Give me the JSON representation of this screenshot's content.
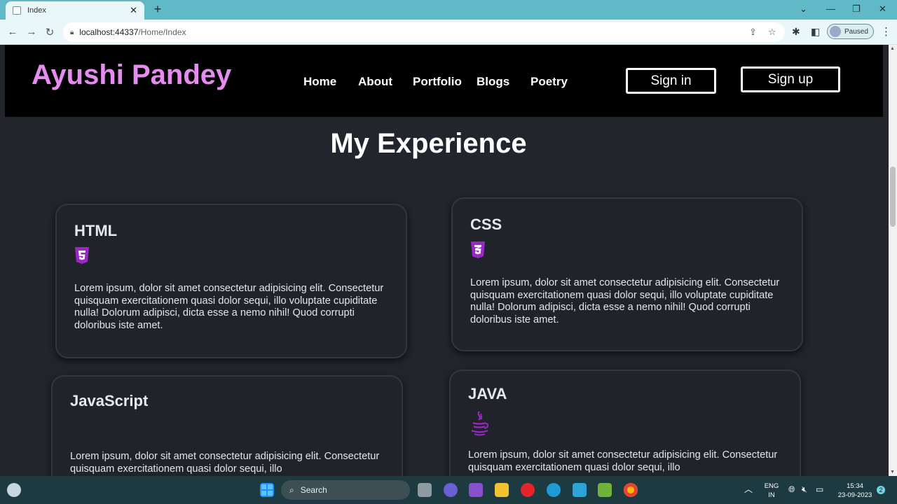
{
  "browser": {
    "tab_title": "Index",
    "tab_close": "✕",
    "new_tab": "+",
    "url_host": "localhost:44337",
    "url_path": "/Home/Index",
    "profile_status": "Paused",
    "window_min": "—",
    "window_restore": "❐",
    "window_close": "✕",
    "chevron": "⌄"
  },
  "site": {
    "brand": "Ayushi Pandey",
    "nav": [
      "Home",
      "About",
      "Portfolio",
      "Blogs",
      "Poetry"
    ],
    "sign_in": "Sign in",
    "sign_up": "Sign up",
    "section_title": "My Experience"
  },
  "cards": [
    {
      "title": "HTML",
      "icon": "html5-icon",
      "text": "Lorem ipsum, dolor sit amet consectetur adipisicing elit. Consectetur quisquam exercitationem quasi dolor sequi, illo voluptate cupiditate nulla! Dolorum adipisci, dicta esse a nemo nihil! Quod corrupti doloribus iste amet."
    },
    {
      "title": "CSS",
      "icon": "css3-icon",
      "text": "Lorem ipsum, dolor sit amet consectetur adipisicing elit. Consectetur quisquam exercitationem quasi dolor sequi, illo voluptate cupiditate nulla! Dolorum adipisci, dicta esse a nemo nihil! Quod corrupti doloribus iste amet."
    },
    {
      "title": "JavaScript",
      "icon": "",
      "text": "Lorem ipsum, dolor sit amet consectetur adipisicing elit. Consectetur quisquam exercitationem quasi dolor sequi, illo"
    },
    {
      "title": "JAVA",
      "icon": "java-icon",
      "text": "Lorem ipsum, dolor sit amet consectetur adipisicing elit. Consectetur quisquam exercitationem quasi dolor sequi, illo"
    }
  ],
  "taskbar": {
    "search_label": "Search",
    "lang_line1": "ENG",
    "lang_line2": "IN",
    "time": "15:34",
    "date": "23-09-2023",
    "notification_count": "2"
  },
  "colors": {
    "brand": "#e68bf0",
    "icon_purple": "#9b27c9",
    "chrome_accent": "#5fb9c6"
  }
}
